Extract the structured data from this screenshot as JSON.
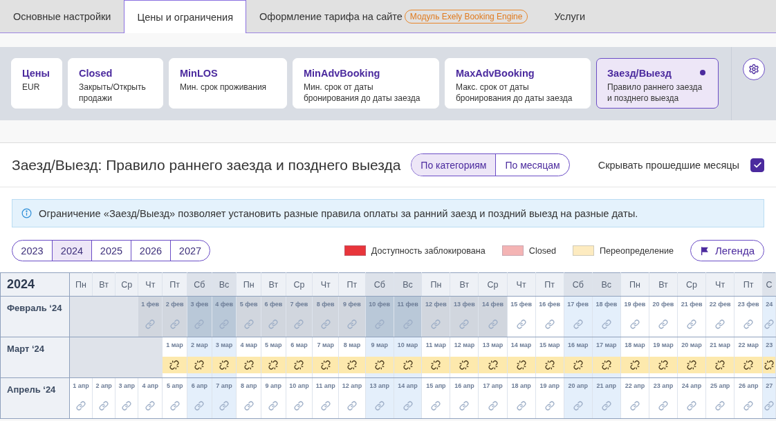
{
  "tabs": [
    {
      "label": "Основные настройки",
      "selected": false
    },
    {
      "label": "Цены и ограничения",
      "selected": true
    },
    {
      "label": "Оформление тарифа на сайте",
      "badge": "Модуль Exely Booking Engine",
      "selected": false
    },
    {
      "label": "Услуги",
      "selected": false
    }
  ],
  "restriction_cards": [
    {
      "title": "Цены",
      "subtitle": "EUR",
      "selected": false,
      "indicator": false
    },
    {
      "title": "Closed",
      "subtitle": "Закрыть/Открыть продажи",
      "selected": false,
      "indicator": false
    },
    {
      "title": "MinLOS",
      "subtitle": "Мин. срок проживания",
      "selected": false,
      "indicator": false
    },
    {
      "title": "MinAdvBooking",
      "subtitle": "Мин. срок от даты бронирования до даты заезда",
      "selected": false,
      "indicator": false
    },
    {
      "title": "MaxAdvBooking",
      "subtitle": "Макс. срок от даты бронирования до даты заезда",
      "selected": false,
      "indicator": false
    },
    {
      "title": "Заезд/Выезд",
      "subtitle": "Правило раннего заезда и позднего выезда",
      "selected": true,
      "indicator": true
    }
  ],
  "section": {
    "title": "Заезд/Выезд: Правило раннего заезда и позднего выезда",
    "view_toggle": [
      {
        "label": "По категориям",
        "selected": true
      },
      {
        "label": "По месяцам",
        "selected": false
      }
    ],
    "hide_past": {
      "label": "Скрывать прошедшие месяцы",
      "checked": true
    }
  },
  "info_banner": {
    "text": "Ограничение «Заезд/Выезд» позволяет установить разные правила оплаты за ранний заезд и поздний выезд на разные даты."
  },
  "years": [
    {
      "label": "2023",
      "selected": false
    },
    {
      "label": "2024",
      "selected": true
    },
    {
      "label": "2025",
      "selected": false
    },
    {
      "label": "2026",
      "selected": false
    },
    {
      "label": "2027",
      "selected": false
    }
  ],
  "legend": [
    {
      "label": "Доступность заблокирована",
      "color": "#e8353b"
    },
    {
      "label": "Closed",
      "color": "#f4b4b4"
    },
    {
      "label": "Переопределение",
      "color": "#fdebc0"
    }
  ],
  "legend_button": {
    "label": "Легенда"
  },
  "calendar": {
    "year": "2024",
    "weekdays": [
      {
        "label": "Пн",
        "weekend": false
      },
      {
        "label": "Вт",
        "weekend": false
      },
      {
        "label": "Ср",
        "weekend": false
      },
      {
        "label": "Чт",
        "weekend": false
      },
      {
        "label": "Пт",
        "weekend": false
      },
      {
        "label": "Сб",
        "weekend": true
      },
      {
        "label": "Вс",
        "weekend": true
      },
      {
        "label": "Пн",
        "weekend": false
      },
      {
        "label": "Вт",
        "weekend": false
      },
      {
        "label": "Ср",
        "weekend": false
      },
      {
        "label": "Чт",
        "weekend": false
      },
      {
        "label": "Пт",
        "weekend": false
      },
      {
        "label": "Сб",
        "weekend": true
      },
      {
        "label": "Вс",
        "weekend": true
      },
      {
        "label": "Пн",
        "weekend": false
      },
      {
        "label": "Вт",
        "weekend": false
      },
      {
        "label": "Ср",
        "weekend": false
      },
      {
        "label": "Чт",
        "weekend": false
      },
      {
        "label": "Пт",
        "weekend": false
      },
      {
        "label": "Сб",
        "weekend": true
      },
      {
        "label": "Вс",
        "weekend": true
      },
      {
        "label": "Пн",
        "weekend": false
      },
      {
        "label": "Вт",
        "weekend": false
      },
      {
        "label": "Ср",
        "weekend": false
      },
      {
        "label": "Чт",
        "weekend": false
      },
      {
        "label": "Пт",
        "weekend": false
      },
      {
        "label": "С",
        "weekend": true
      }
    ],
    "months": [
      {
        "name": "Февраль ‘24",
        "cells": [
          {
            "kind": "blank"
          },
          {
            "kind": "blank"
          },
          {
            "kind": "blank"
          },
          {
            "kind": "day",
            "date": "1 фев",
            "past": true,
            "override": false
          },
          {
            "kind": "day",
            "date": "2 фев",
            "past": true,
            "override": false
          },
          {
            "kind": "day",
            "date": "3 фев",
            "past": true,
            "override": false
          },
          {
            "kind": "day",
            "date": "4 фев",
            "past": true,
            "override": false
          },
          {
            "kind": "day",
            "date": "5 фев",
            "past": true,
            "override": false
          },
          {
            "kind": "day",
            "date": "6 фев",
            "past": true,
            "override": false
          },
          {
            "kind": "day",
            "date": "7 фев",
            "past": true,
            "override": false
          },
          {
            "kind": "day",
            "date": "8 фев",
            "past": true,
            "override": false
          },
          {
            "kind": "day",
            "date": "9 фев",
            "past": true,
            "override": false
          },
          {
            "kind": "day",
            "date": "10 фев",
            "past": true,
            "override": false
          },
          {
            "kind": "day",
            "date": "11 фев",
            "past": true,
            "override": false
          },
          {
            "kind": "day",
            "date": "12 фев",
            "past": true,
            "override": false
          },
          {
            "kind": "day",
            "date": "13 фев",
            "past": true,
            "override": false
          },
          {
            "kind": "day",
            "date": "14 фев",
            "past": true,
            "override": false
          },
          {
            "kind": "day",
            "date": "15 фев",
            "past": false,
            "override": false
          },
          {
            "kind": "day",
            "date": "16 фев",
            "past": false,
            "override": false
          },
          {
            "kind": "day",
            "date": "17 фев",
            "past": false,
            "override": false
          },
          {
            "kind": "day",
            "date": "18 фев",
            "past": false,
            "override": false
          },
          {
            "kind": "day",
            "date": "19 фев",
            "past": false,
            "override": false
          },
          {
            "kind": "day",
            "date": "20 фев",
            "past": false,
            "override": false
          },
          {
            "kind": "day",
            "date": "21 фев",
            "past": false,
            "override": false
          },
          {
            "kind": "day",
            "date": "22 фев",
            "past": false,
            "override": false
          },
          {
            "kind": "day",
            "date": "23 фев",
            "past": false,
            "override": false
          },
          {
            "kind": "day",
            "date": "24",
            "past": false,
            "override": false
          }
        ]
      },
      {
        "name": "Март ‘24",
        "cells": [
          {
            "kind": "blank"
          },
          {
            "kind": "blank"
          },
          {
            "kind": "blank"
          },
          {
            "kind": "blank"
          },
          {
            "kind": "day",
            "date": "1 мар",
            "past": false,
            "override": true
          },
          {
            "kind": "day",
            "date": "2 мар",
            "past": false,
            "override": true
          },
          {
            "kind": "day",
            "date": "3 мар",
            "past": false,
            "override": true
          },
          {
            "kind": "day",
            "date": "4 мар",
            "past": false,
            "override": true
          },
          {
            "kind": "day",
            "date": "5 мар",
            "past": false,
            "override": true
          },
          {
            "kind": "day",
            "date": "6 мар",
            "past": false,
            "override": true
          },
          {
            "kind": "day",
            "date": "7 мар",
            "past": false,
            "override": true
          },
          {
            "kind": "day",
            "date": "8 мар",
            "past": false,
            "override": true
          },
          {
            "kind": "day",
            "date": "9 мар",
            "past": false,
            "override": true
          },
          {
            "kind": "day",
            "date": "10 мар",
            "past": false,
            "override": true
          },
          {
            "kind": "day",
            "date": "11 мар",
            "past": false,
            "override": true
          },
          {
            "kind": "day",
            "date": "12 мар",
            "past": false,
            "override": true
          },
          {
            "kind": "day",
            "date": "13 мар",
            "past": false,
            "override": true
          },
          {
            "kind": "day",
            "date": "14 мар",
            "past": false,
            "override": true
          },
          {
            "kind": "day",
            "date": "15 мар",
            "past": false,
            "override": true
          },
          {
            "kind": "day",
            "date": "16 мар",
            "past": false,
            "override": true
          },
          {
            "kind": "day",
            "date": "17 мар",
            "past": false,
            "override": true
          },
          {
            "kind": "day",
            "date": "18 мар",
            "past": false,
            "override": true
          },
          {
            "kind": "day",
            "date": "19 мар",
            "past": false,
            "override": true
          },
          {
            "kind": "day",
            "date": "20 мар",
            "past": false,
            "override": true
          },
          {
            "kind": "day",
            "date": "21 мар",
            "past": false,
            "override": true
          },
          {
            "kind": "day",
            "date": "22 мар",
            "past": false,
            "override": true
          },
          {
            "kind": "day",
            "date": "23",
            "past": false,
            "override": true
          }
        ]
      },
      {
        "name": "Апрель ‘24",
        "cells": [
          {
            "kind": "day",
            "date": "1 апр",
            "past": false,
            "override": false
          },
          {
            "kind": "day",
            "date": "2 апр",
            "past": false,
            "override": false
          },
          {
            "kind": "day",
            "date": "3 апр",
            "past": false,
            "override": false
          },
          {
            "kind": "day",
            "date": "4 апр",
            "past": false,
            "override": false
          },
          {
            "kind": "day",
            "date": "5 апр",
            "past": false,
            "override": false
          },
          {
            "kind": "day",
            "date": "6 апр",
            "past": false,
            "override": false
          },
          {
            "kind": "day",
            "date": "7 апр",
            "past": false,
            "override": false
          },
          {
            "kind": "day",
            "date": "8 апр",
            "past": false,
            "override": false
          },
          {
            "kind": "day",
            "date": "9 апр",
            "past": false,
            "override": false
          },
          {
            "kind": "day",
            "date": "10 апр",
            "past": false,
            "override": false
          },
          {
            "kind": "day",
            "date": "11 апр",
            "past": false,
            "override": false
          },
          {
            "kind": "day",
            "date": "12 апр",
            "past": false,
            "override": false
          },
          {
            "kind": "day",
            "date": "13 апр",
            "past": false,
            "override": false
          },
          {
            "kind": "day",
            "date": "14 апр",
            "past": false,
            "override": false
          },
          {
            "kind": "day",
            "date": "15 апр",
            "past": false,
            "override": false
          },
          {
            "kind": "day",
            "date": "16 апр",
            "past": false,
            "override": false
          },
          {
            "kind": "day",
            "date": "17 апр",
            "past": false,
            "override": false
          },
          {
            "kind": "day",
            "date": "18 апр",
            "past": false,
            "override": false
          },
          {
            "kind": "day",
            "date": "19 апр",
            "past": false,
            "override": false
          },
          {
            "kind": "day",
            "date": "20 апр",
            "past": false,
            "override": false
          },
          {
            "kind": "day",
            "date": "21 апр",
            "past": false,
            "override": false
          },
          {
            "kind": "day",
            "date": "22 апр",
            "past": false,
            "override": false
          },
          {
            "kind": "day",
            "date": "23 апр",
            "past": false,
            "override": false
          },
          {
            "kind": "day",
            "date": "24 апр",
            "past": false,
            "override": false
          },
          {
            "kind": "day",
            "date": "25 апр",
            "past": false,
            "override": false
          },
          {
            "kind": "day",
            "date": "26 апр",
            "past": false,
            "override": false
          },
          {
            "kind": "day",
            "date": "27",
            "past": false,
            "override": false
          }
        ]
      }
    ]
  }
}
